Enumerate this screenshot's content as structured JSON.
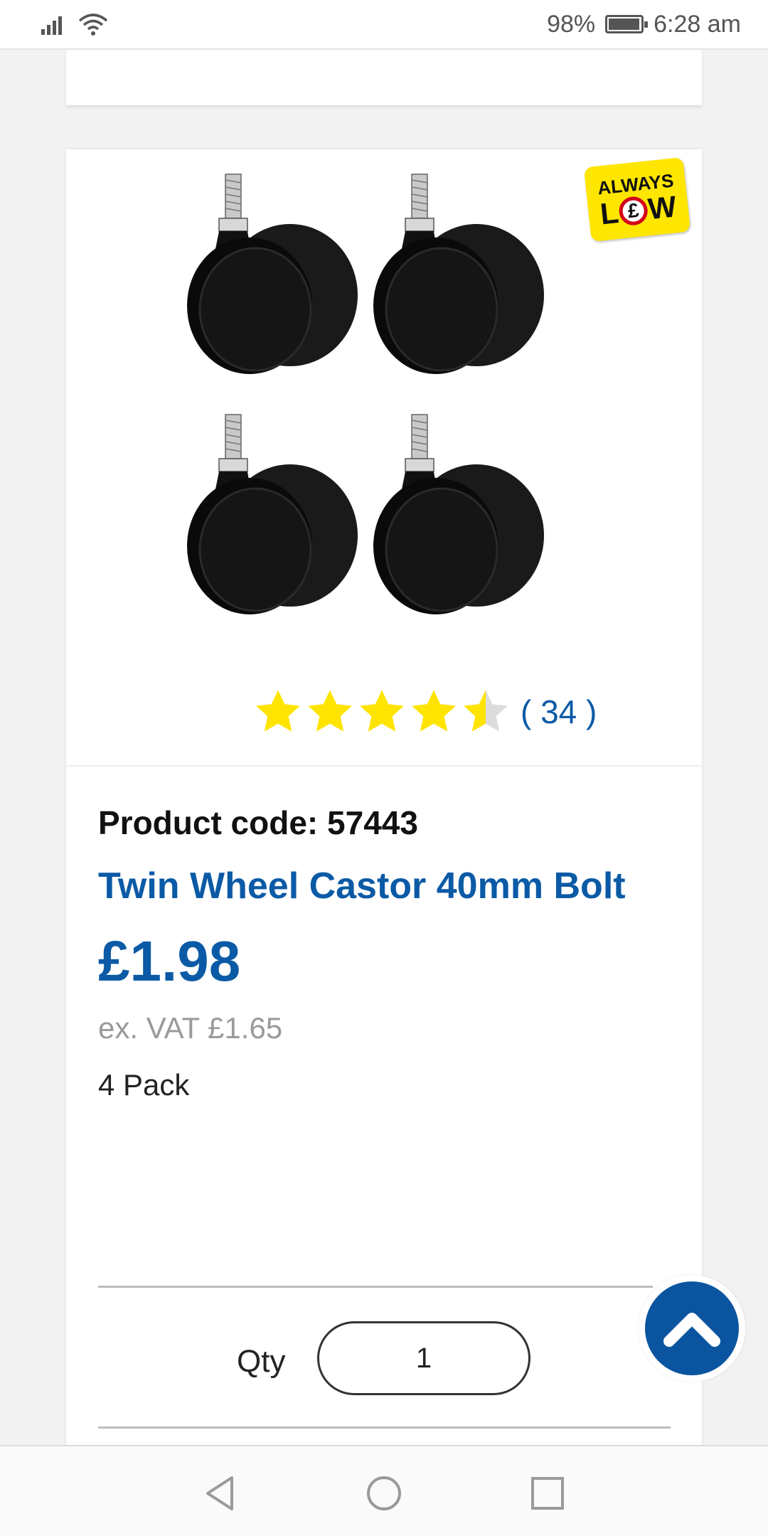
{
  "status_bar": {
    "battery": "98%",
    "time": "6:28 am"
  },
  "product": {
    "badge_top": "ALWAYS",
    "badge_left": "L",
    "badge_pound": "£",
    "badge_right": "W",
    "rating_value": 4.5,
    "review_count": "( 34 )",
    "code_label": "Product code: 57443",
    "title": "Twin Wheel Castor 40mm Bolt",
    "price": "£1.98",
    "ex_vat": "ex. VAT £1.65",
    "pack": "4 Pack",
    "qty_label": "Qty",
    "qty_value": "1"
  },
  "colors": {
    "brand_blue": "#0b5aa6",
    "star_yellow": "#ffe400",
    "badge_yellow": "#ffe600"
  }
}
